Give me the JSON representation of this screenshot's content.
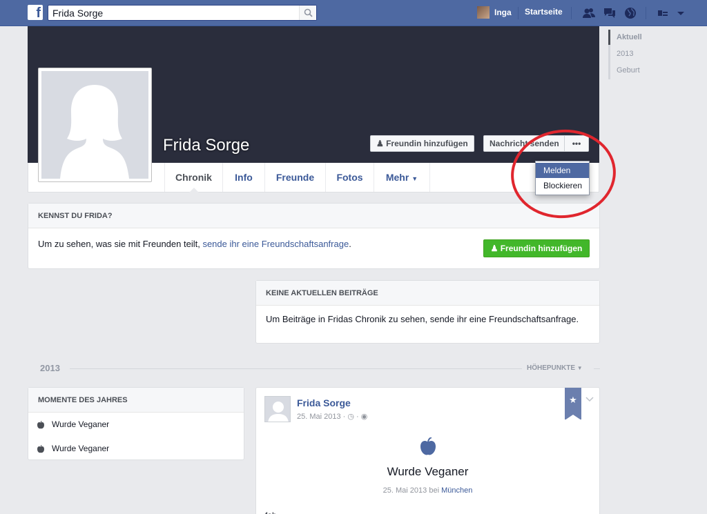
{
  "topbar": {
    "search_value": "Frida Sorge",
    "user_name": "Inga",
    "home_label": "Startseite"
  },
  "timeline_nav": [
    "Aktuell",
    "2013",
    "Geburt"
  ],
  "profile": {
    "name": "Frida Sorge",
    "add_friend_label": "Freundin hinzufügen",
    "message_label": "Nachricht senden",
    "more_label": "•••"
  },
  "tabs": [
    "Chronik",
    "Info",
    "Freunde",
    "Fotos",
    "Mehr"
  ],
  "dropdown": {
    "items": [
      "Melden",
      "Blockieren"
    ]
  },
  "kennst": {
    "title": "KENNST DU FRIDA?",
    "text": "Um zu sehen, was sie mit Freunden teilt, ",
    "link": "sende ihr eine Freundschaftsanfrage",
    "text_end": ".",
    "button_label": "Freundin hinzufügen"
  },
  "keine": {
    "title": "KEINE AKTUELLEN BEITRÄGE",
    "text": "Um Beiträge in Fridas Chronik zu sehen, sende ihr eine Freundschaftsanfrage."
  },
  "year": {
    "label": "2013",
    "highlights_label": "HÖHEPUNKTE"
  },
  "momente": {
    "title": "MOMENTE DES JAHRES",
    "items": [
      "Wurde Veganer",
      "Wurde Veganer"
    ]
  },
  "post": {
    "author": "Frida Sorge",
    "date": "25. Mai 2013 ·",
    "title": "Wurde Veganer",
    "sub_date": "25. Mai 2013 bei ",
    "sub_place": "München",
    "text": "fab"
  },
  "colors": {
    "brand": "#4e69a2",
    "green": "#42b72a",
    "highlight_circle": "#e0262e"
  }
}
